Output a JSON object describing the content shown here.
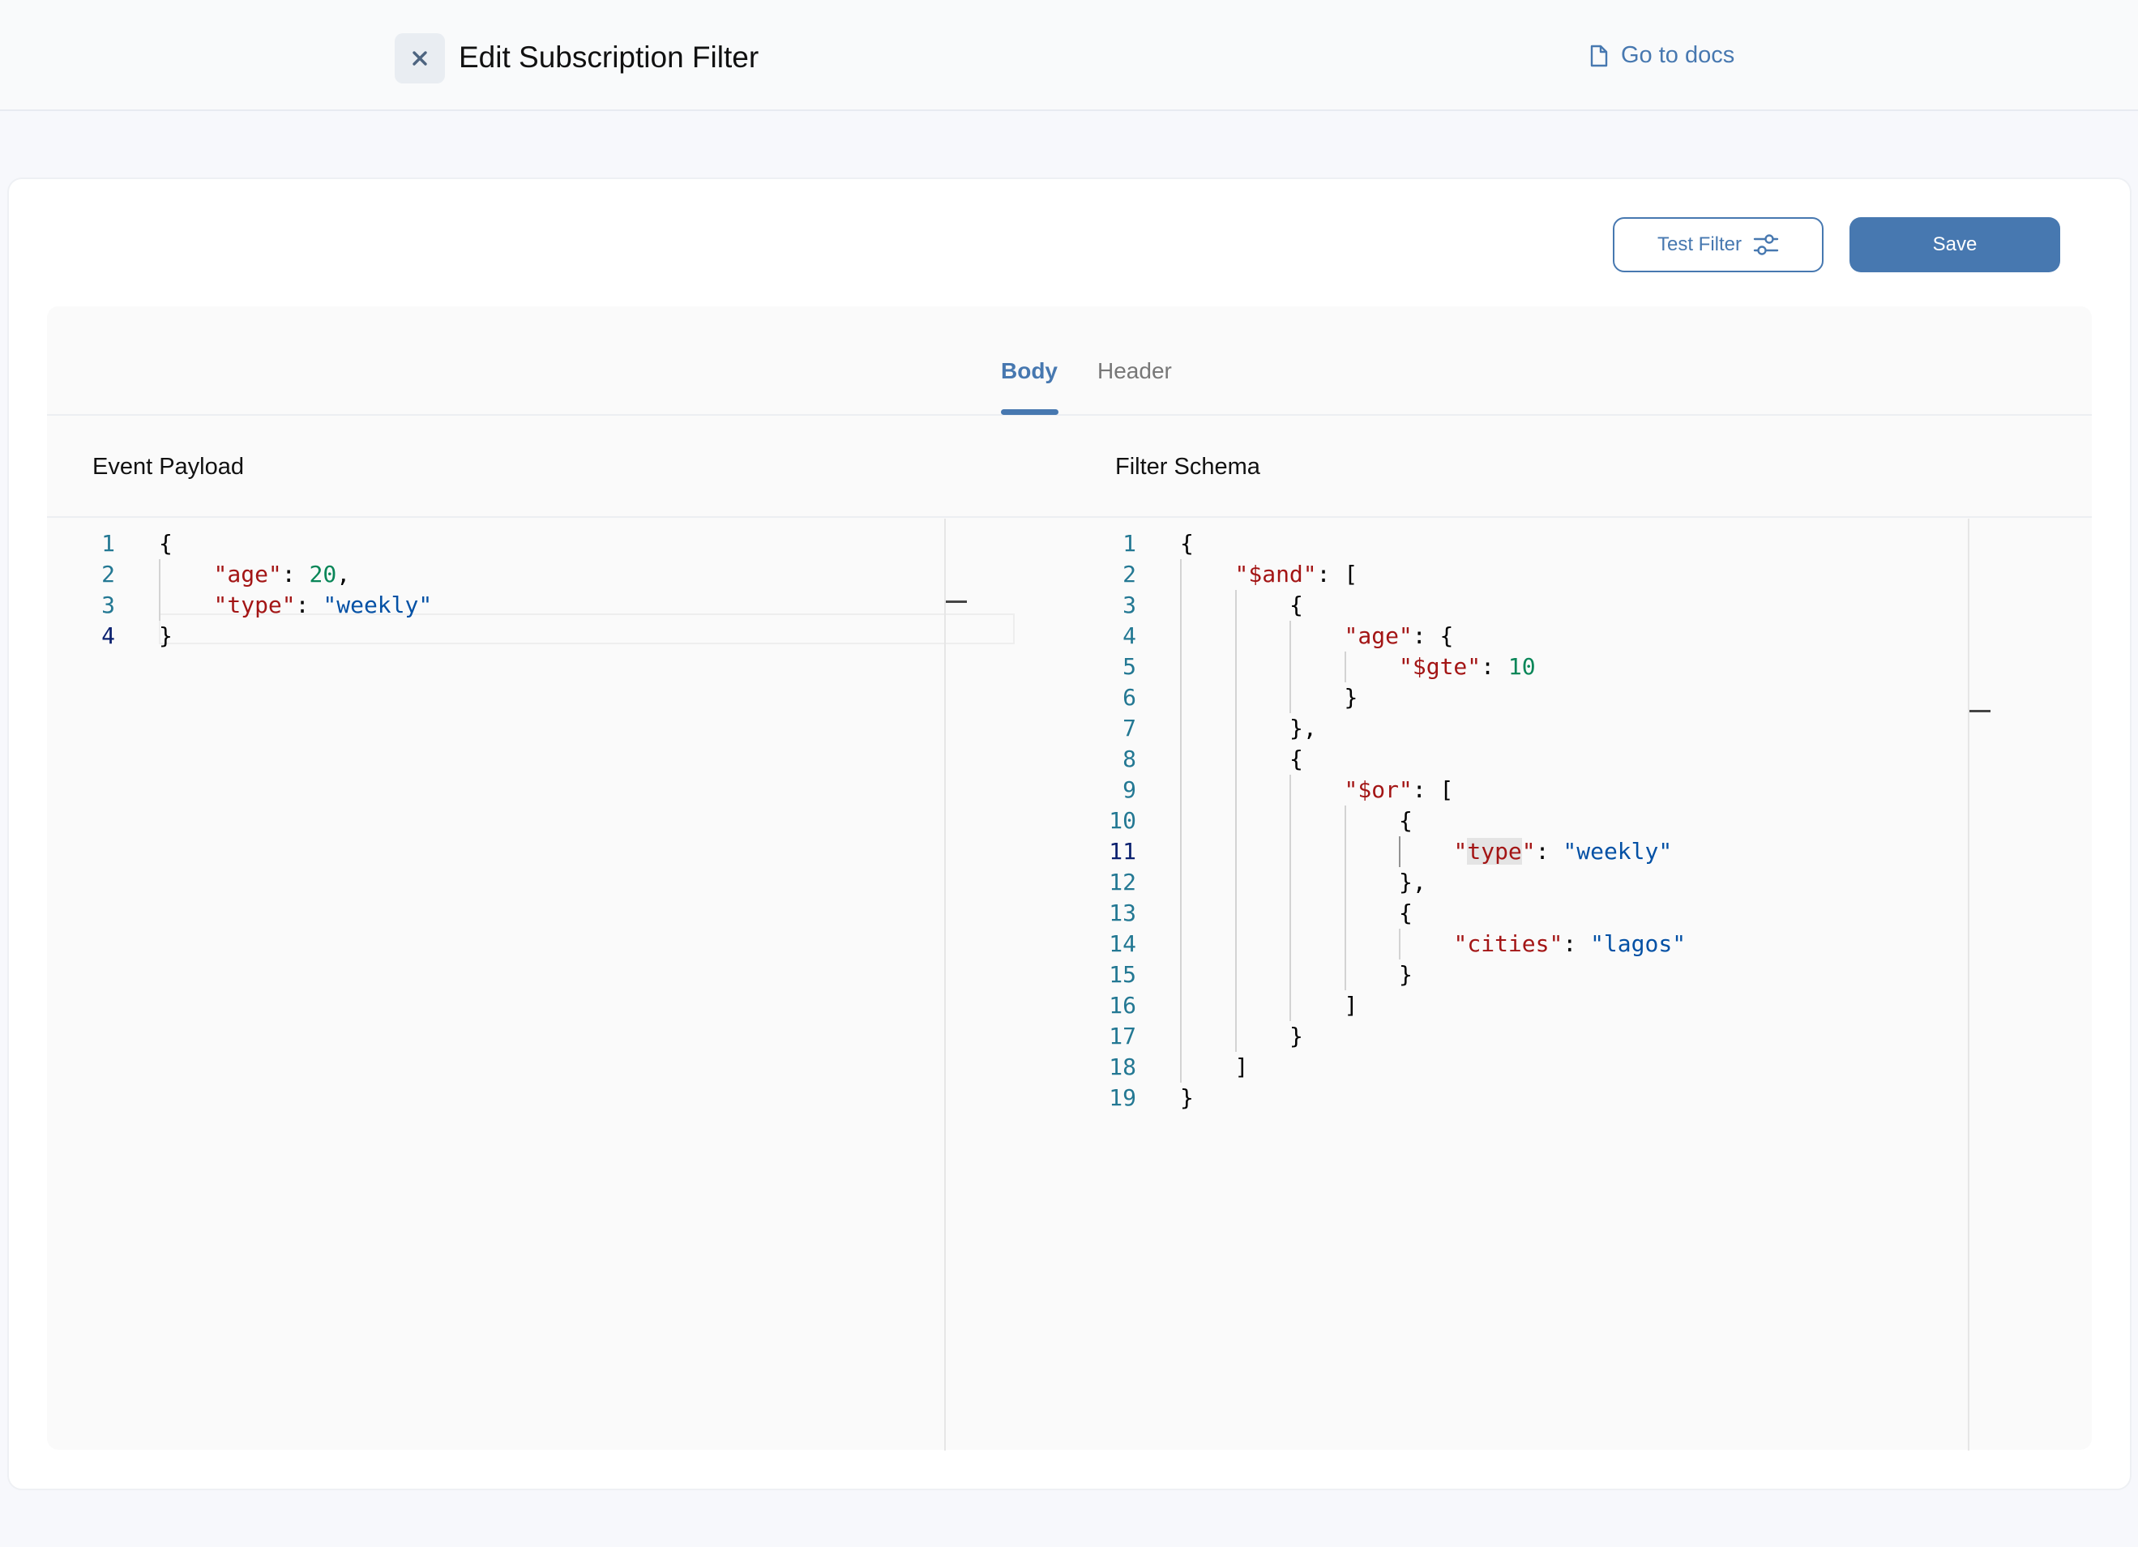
{
  "header": {
    "title": "Edit Subscription Filter",
    "docs_label": "Go to docs",
    "close_icon": "close-icon",
    "docs_icon": "document-icon"
  },
  "toolbar": {
    "test_label": "Test Filter",
    "test_icon": "sliders-icon",
    "save_label": "Save"
  },
  "tabs": [
    {
      "label": "Body",
      "active": true
    },
    {
      "label": "Header",
      "active": false
    }
  ],
  "sections": {
    "payload_label": "Event Payload",
    "schema_label": "Filter Schema"
  },
  "payload_lines": [
    {
      "n": "1",
      "indent": 0,
      "tokens": [
        {
          "t": "p",
          "v": "{"
        }
      ]
    },
    {
      "n": "2",
      "indent": 1,
      "tokens": [
        {
          "t": "k",
          "v": "\"age\""
        },
        {
          "t": "p",
          "v": ": "
        },
        {
          "t": "n",
          "v": "20"
        },
        {
          "t": "p",
          "v": ","
        }
      ]
    },
    {
      "n": "3",
      "indent": 1,
      "tokens": [
        {
          "t": "k",
          "v": "\"type\""
        },
        {
          "t": "p",
          "v": ": "
        },
        {
          "t": "s",
          "v": "\"weekly\""
        }
      ]
    },
    {
      "n": "4",
      "indent": 0,
      "tokens": [
        {
          "t": "p",
          "v": "}"
        }
      ]
    }
  ],
  "schema_lines": [
    {
      "n": "1",
      "indent": 0,
      "tokens": [
        {
          "t": "p",
          "v": "{"
        }
      ]
    },
    {
      "n": "2",
      "indent": 1,
      "tokens": [
        {
          "t": "k",
          "v": "\"$and\""
        },
        {
          "t": "p",
          "v": ": ["
        }
      ]
    },
    {
      "n": "3",
      "indent": 2,
      "tokens": [
        {
          "t": "p",
          "v": "{"
        }
      ]
    },
    {
      "n": "4",
      "indent": 3,
      "tokens": [
        {
          "t": "k",
          "v": "\"age\""
        },
        {
          "t": "p",
          "v": ": {"
        }
      ]
    },
    {
      "n": "5",
      "indent": 4,
      "tokens": [
        {
          "t": "k",
          "v": "\"$gte\""
        },
        {
          "t": "p",
          "v": ": "
        },
        {
          "t": "n",
          "v": "10"
        }
      ]
    },
    {
      "n": "6",
      "indent": 3,
      "tokens": [
        {
          "t": "p",
          "v": "}"
        }
      ]
    },
    {
      "n": "7",
      "indent": 2,
      "tokens": [
        {
          "t": "p",
          "v": "},"
        }
      ]
    },
    {
      "n": "8",
      "indent": 2,
      "tokens": [
        {
          "t": "p",
          "v": "{"
        }
      ]
    },
    {
      "n": "9",
      "indent": 3,
      "tokens": [
        {
          "t": "k",
          "v": "\"$or\""
        },
        {
          "t": "p",
          "v": ": ["
        }
      ]
    },
    {
      "n": "10",
      "indent": 4,
      "tokens": [
        {
          "t": "p",
          "v": "{"
        }
      ]
    },
    {
      "n": "11",
      "indent": 5,
      "tokens": [
        {
          "t": "k",
          "v": "\""
        },
        {
          "t": "kh",
          "v": "type"
        },
        {
          "t": "k",
          "v": "\""
        },
        {
          "t": "p",
          "v": ": "
        },
        {
          "t": "s",
          "v": "\"weekly\""
        }
      ]
    },
    {
      "n": "12",
      "indent": 4,
      "tokens": [
        {
          "t": "p",
          "v": "},"
        }
      ]
    },
    {
      "n": "13",
      "indent": 4,
      "tokens": [
        {
          "t": "p",
          "v": "{"
        }
      ]
    },
    {
      "n": "14",
      "indent": 5,
      "tokens": [
        {
          "t": "k",
          "v": "\"cities\""
        },
        {
          "t": "p",
          "v": ": "
        },
        {
          "t": "s",
          "v": "\"lagos\""
        }
      ]
    },
    {
      "n": "15",
      "indent": 4,
      "tokens": [
        {
          "t": "p",
          "v": "}"
        }
      ]
    },
    {
      "n": "16",
      "indent": 3,
      "tokens": [
        {
          "t": "p",
          "v": "]"
        }
      ]
    },
    {
      "n": "17",
      "indent": 2,
      "tokens": [
        {
          "t": "p",
          "v": "}"
        }
      ]
    },
    {
      "n": "18",
      "indent": 1,
      "tokens": [
        {
          "t": "p",
          "v": "]"
        }
      ]
    },
    {
      "n": "19",
      "indent": 0,
      "tokens": [
        {
          "t": "p",
          "v": "}"
        }
      ]
    }
  ],
  "payload_active_line": "4",
  "schema_active_line": "11",
  "colors": {
    "accent": "#4778b0",
    "key": "#a31515",
    "string": "#0451a5",
    "number": "#098658",
    "line_number": "#237893"
  }
}
